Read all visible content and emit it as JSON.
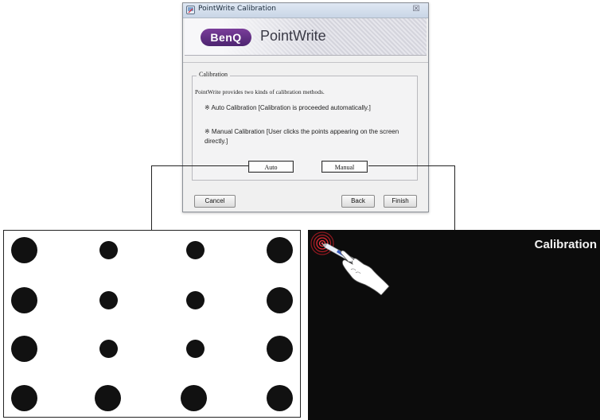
{
  "dialog": {
    "title": "PointWrite Calibration",
    "close_glyph": "☒",
    "brand": "BenQ",
    "product": "PointWrite",
    "group_title": "Calibration",
    "intro": "PointWrite provides two kinds of calibration methods.",
    "auto_desc": "※ Auto Calibration [Calibration is proceeded automatically.]",
    "manual_desc": "※ Manual Calibration [User clicks the points appearing on the screen directly.]",
    "auto_button": "Auto",
    "manual_button": "Manual",
    "cancel_button": "Cancel",
    "back_button": "Back",
    "finish_button": "Finish"
  },
  "manual_screen": {
    "title": "Calibration",
    "icons": [
      "target-icon",
      "pointing-hand-pen-icon"
    ]
  },
  "auto_screen": {
    "rows": 4,
    "columns": 4
  },
  "colors": {
    "brand_purple": "#5b2d80",
    "manual_background": "#0c0c0c",
    "target_red": "#d0202a"
  }
}
